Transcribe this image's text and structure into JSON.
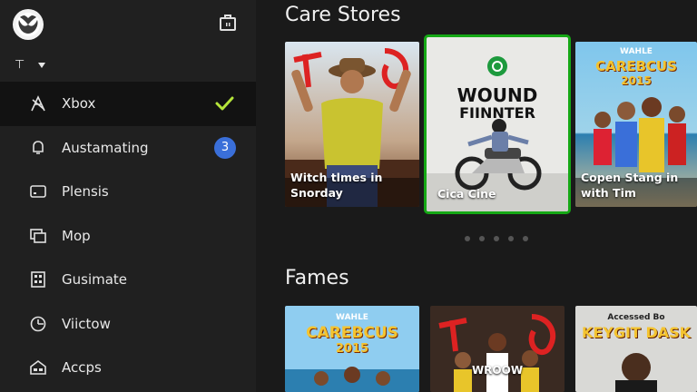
{
  "sidebar": {
    "profile_glyph": "⊤",
    "items": [
      {
        "label": "Xbox",
        "icon": "xbox-home-icon",
        "selected": true,
        "checked": true
      },
      {
        "label": "Austamating",
        "icon": "notification-bell-icon",
        "badge": "3"
      },
      {
        "label": "Plensis",
        "icon": "tv-icon"
      },
      {
        "label": "Mop",
        "icon": "gallery-icon"
      },
      {
        "label": "Gusimate",
        "icon": "grid-building-icon"
      },
      {
        "label": "Viictow",
        "icon": "clock-icon"
      },
      {
        "label": "Accps",
        "icon": "apps-icon"
      }
    ]
  },
  "sections": [
    {
      "title": "Care Stores",
      "cards": [
        {
          "caption": "Witch tlmes in\nSnorday"
        },
        {
          "caption": "Cica Cine",
          "poster_title_1": "WOUND",
          "poster_title_2": "FIINNTER",
          "focused": true
        },
        {
          "caption": "Copen Stang in\nwith Tim",
          "poster_title_1": "WAHLE",
          "poster_title_2": "CAREBCUS",
          "poster_title_3": "2015"
        }
      ],
      "page_dots": 5
    },
    {
      "title": "Fames",
      "cards": [
        {
          "poster_title_1": "WAHLE",
          "poster_title_2": "CAREBCUS",
          "poster_title_3": "2015"
        },
        {
          "poster_title_1": "WROOW"
        },
        {
          "poster_title_1": "Accessed Bo",
          "poster_title_2": "KEYGIT DASK"
        }
      ]
    }
  ],
  "colors": {
    "accent_green": "#15a815",
    "badge_blue": "#3a6fd9",
    "sidebar_bg": "#202020",
    "main_bg": "#1a1a1a"
  }
}
